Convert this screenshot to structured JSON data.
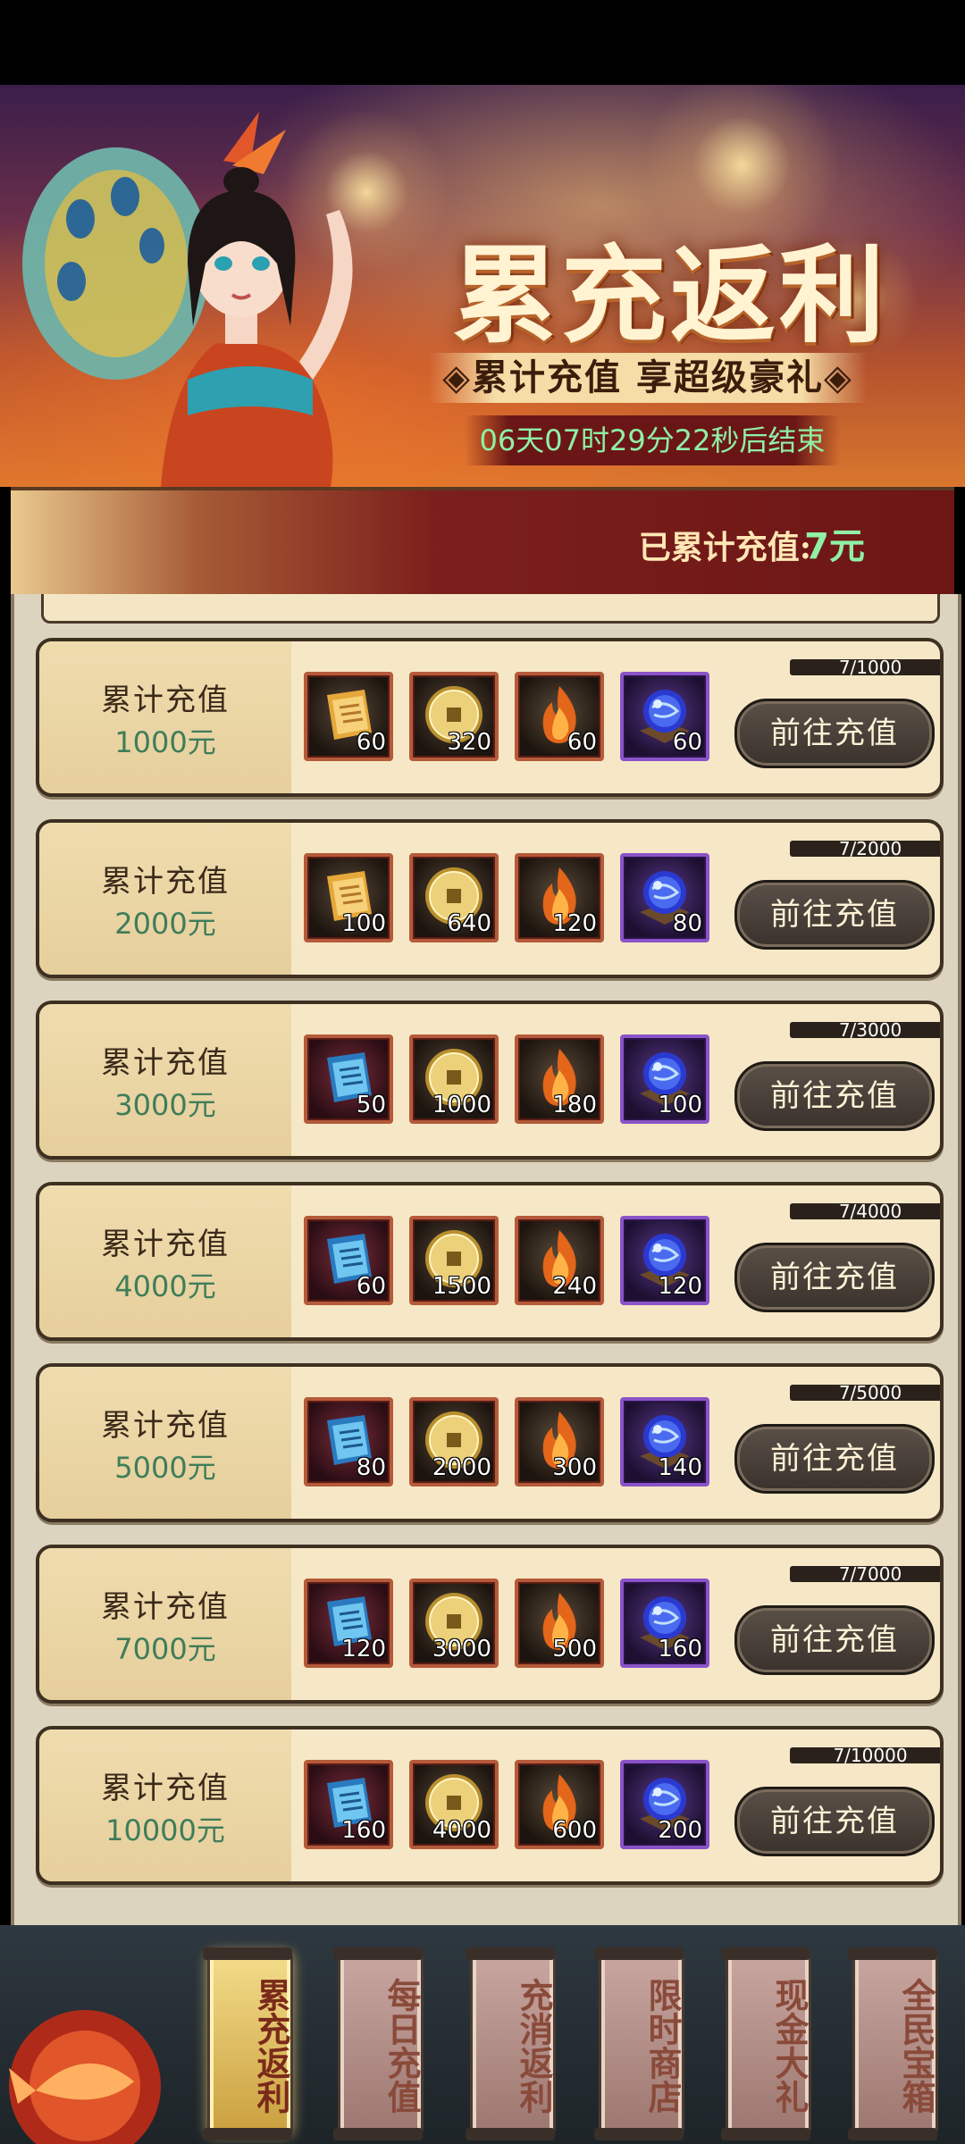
{
  "banner": {
    "title": "累充返利",
    "subtitle": "◈累计充值 享超级豪礼◈",
    "countdown": "06天07时29分22秒后结束"
  },
  "accumulated": {
    "label": "已累计充值:",
    "value": "7元"
  },
  "tiers": [
    {
      "label": "累计充值",
      "amount": "1000元",
      "progress": "7/1000",
      "button": "前往充值",
      "rewards": [
        {
          "icon": "scroll-gold",
          "count": "60"
        },
        {
          "icon": "coin",
          "count": "320"
        },
        {
          "icon": "flame",
          "count": "60"
        },
        {
          "icon": "orb",
          "count": "60"
        }
      ]
    },
    {
      "label": "累计充值",
      "amount": "2000元",
      "progress": "7/2000",
      "button": "前往充值",
      "rewards": [
        {
          "icon": "scroll-gold",
          "count": "100"
        },
        {
          "icon": "coin",
          "count": "640"
        },
        {
          "icon": "flame",
          "count": "120"
        },
        {
          "icon": "orb",
          "count": "80"
        }
      ]
    },
    {
      "label": "累计充值",
      "amount": "3000元",
      "progress": "7/3000",
      "button": "前往充值",
      "rewards": [
        {
          "icon": "scroll-blue",
          "count": "50"
        },
        {
          "icon": "coin",
          "count": "1000"
        },
        {
          "icon": "flame",
          "count": "180"
        },
        {
          "icon": "orb",
          "count": "100"
        }
      ]
    },
    {
      "label": "累计充值",
      "amount": "4000元",
      "progress": "7/4000",
      "button": "前往充值",
      "rewards": [
        {
          "icon": "scroll-blue",
          "count": "60"
        },
        {
          "icon": "coin",
          "count": "1500"
        },
        {
          "icon": "flame",
          "count": "240"
        },
        {
          "icon": "orb",
          "count": "120"
        }
      ]
    },
    {
      "label": "累计充值",
      "amount": "5000元",
      "progress": "7/5000",
      "button": "前往充值",
      "rewards": [
        {
          "icon": "scroll-blue",
          "count": "80"
        },
        {
          "icon": "coin",
          "count": "2000"
        },
        {
          "icon": "flame",
          "count": "300"
        },
        {
          "icon": "orb",
          "count": "140"
        }
      ]
    },
    {
      "label": "累计充值",
      "amount": "7000元",
      "progress": "7/7000",
      "button": "前往充值",
      "rewards": [
        {
          "icon": "scroll-blue",
          "count": "120"
        },
        {
          "icon": "coin",
          "count": "3000"
        },
        {
          "icon": "flame",
          "count": "500"
        },
        {
          "icon": "orb",
          "count": "160"
        }
      ]
    },
    {
      "label": "累计充值",
      "amount": "10000元",
      "progress": "7/10000",
      "button": "前往充值",
      "rewards": [
        {
          "icon": "scroll-blue",
          "count": "160"
        },
        {
          "icon": "coin",
          "count": "4000"
        },
        {
          "icon": "flame",
          "count": "600"
        },
        {
          "icon": "orb",
          "count": "200"
        }
      ]
    }
  ],
  "nav": {
    "tabs": [
      {
        "label": "累充返利",
        "active": true
      },
      {
        "label": "每日充值",
        "active": false
      },
      {
        "label": "充消返利",
        "active": false
      },
      {
        "label": "限时商店",
        "active": false
      },
      {
        "label": "现金大礼",
        "active": false
      },
      {
        "label": "全民宝箱",
        "active": false
      }
    ]
  },
  "colors": {
    "accent_green": "#8ff0a6",
    "amount_green": "#3f7d5a",
    "card_bg": "#f6e8c6",
    "button_bg": "#3a322c"
  }
}
